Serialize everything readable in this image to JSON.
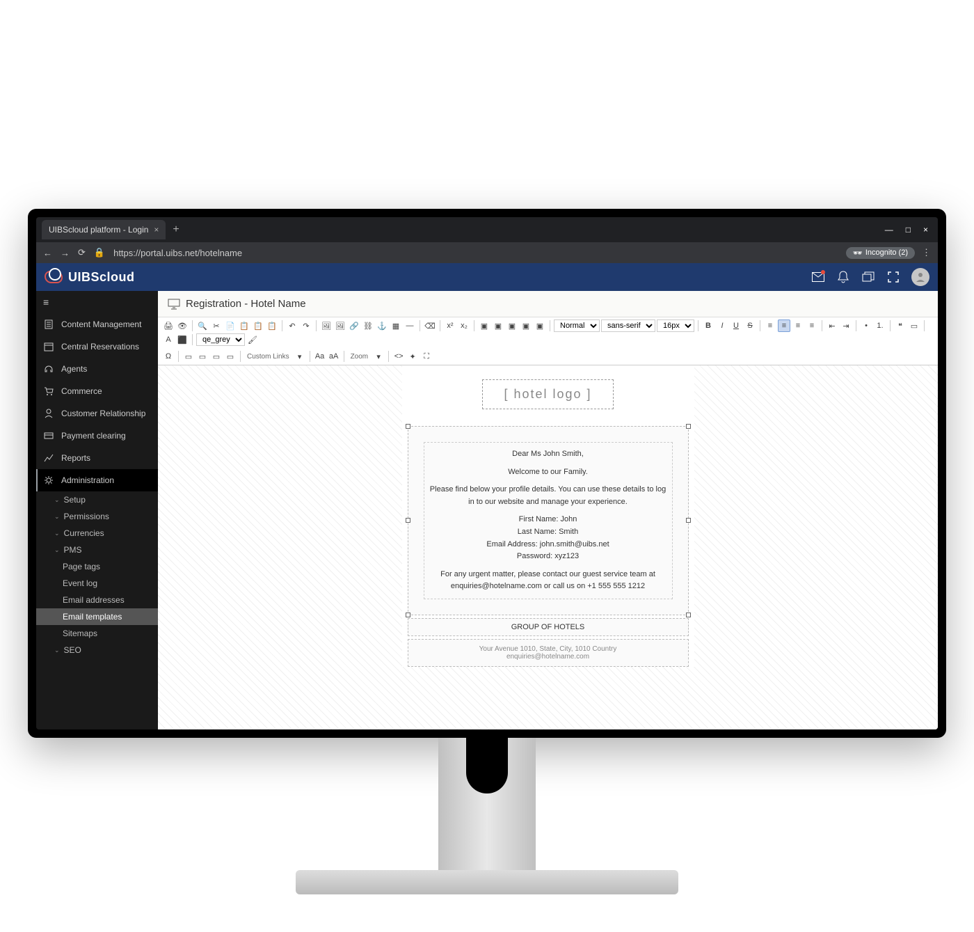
{
  "browser": {
    "tab_title": "UIBScloud platform - Login",
    "url": "https://portal.uibs.net/hotelname",
    "incognito_label": "Incognito (2)"
  },
  "topbar": {
    "brand": "UIBScloud"
  },
  "nav": {
    "items": [
      {
        "icon": "document-icon",
        "label": "Content Management"
      },
      {
        "icon": "calendar-icon",
        "label": "Central Reservations"
      },
      {
        "icon": "headset-icon",
        "label": "Agents"
      },
      {
        "icon": "cart-icon",
        "label": "Commerce"
      },
      {
        "icon": "person-icon",
        "label": "Customer Relationship"
      },
      {
        "icon": "card-icon",
        "label": "Payment clearing"
      },
      {
        "icon": "chart-icon",
        "label": "Reports"
      },
      {
        "icon": "gear-icon",
        "label": "Administration",
        "active": true
      }
    ],
    "admin_sub": [
      {
        "label": "Setup",
        "chev": true
      },
      {
        "label": "Permissions",
        "chev": true
      },
      {
        "label": "Currencies",
        "chev": true
      },
      {
        "label": "PMS",
        "chev": true
      }
    ],
    "leaves": [
      {
        "label": "Page tags"
      },
      {
        "label": "Event log"
      },
      {
        "label": "Email addresses"
      },
      {
        "label": "Email templates",
        "selected": true
      },
      {
        "label": "Sitemaps"
      },
      {
        "label": "SEO",
        "chev": true
      }
    ]
  },
  "page": {
    "title": "Registration - Hotel Name"
  },
  "toolbar": {
    "format_select": "Normal",
    "font_select": "sans-serif",
    "size_select": "16px",
    "theme_select": "qe_grey",
    "custom_links_label": "Custom Links",
    "zoom_label": "Zoom"
  },
  "email": {
    "logo_placeholder": "[ hotel logo ]",
    "greeting": "Dear Ms John Smith,",
    "welcome": "Welcome to our Family.",
    "profile_intro": "Please find below your profile details. You can use these details to log in to our website and manage your experience.",
    "first_name_line": "First Name: John",
    "last_name_line": "Last Name: Smith",
    "email_line": "Email Address: john.smith@uibs.net",
    "password_line": "Password: xyz123",
    "urgent_line": "For any urgent matter, please contact our guest service team at enquiries@hotelname.com or call us on +1 555 555 1212",
    "group_label": "GROUP OF HOTELS",
    "footer_address": "Your Avenue 1010, State, City, 1010 Country",
    "footer_email": "enquiries@hotelname.com"
  }
}
